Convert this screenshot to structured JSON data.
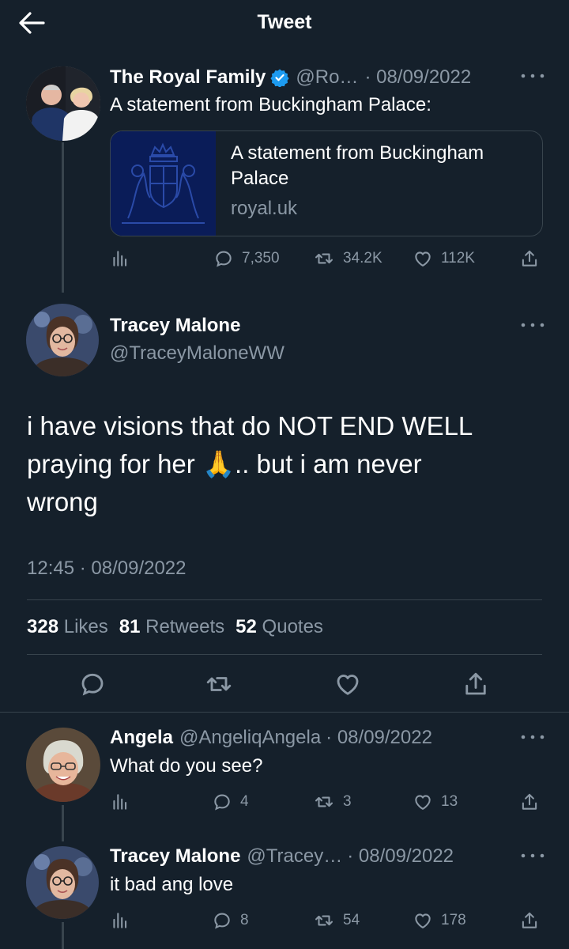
{
  "header": {
    "title": "Tweet"
  },
  "parent_tweet": {
    "display_name": "The Royal Family",
    "handle": "@Ro…",
    "date": "· 08/09/2022",
    "text": "A statement from Buckingham Palace:",
    "card": {
      "title": "A statement from Buckingham Palace",
      "domain": "royal.uk"
    },
    "actions": {
      "replies": "7,350",
      "retweets": "34.2K",
      "likes": "112K"
    }
  },
  "main_tweet": {
    "display_name": "Tracey Malone",
    "handle": "@TraceyMaloneWW",
    "text_line1": "i have  visions that do NOT END WELL",
    "text_line2_a": "praying for her ",
    "emoji": "🙏",
    "text_line2_b": ".. but i am never",
    "text_line3": "wrong",
    "timestamp": "12:45 · 08/09/2022",
    "stats": {
      "likes_count": "328",
      "likes_label": "Likes",
      "retweets_count": "81",
      "retweets_label": "Retweets",
      "quotes_count": "52",
      "quotes_label": "Quotes"
    }
  },
  "replies": [
    {
      "display_name": "Angela",
      "handle": "@AngeliqAngela",
      "date": "· 08/09/2022",
      "text": "What do you see?",
      "replies": "4",
      "retweets": "3",
      "likes": "13"
    },
    {
      "display_name": "Tracey Malone",
      "handle": "@Tracey…",
      "date": "· 08/09/2022",
      "text": "it bad ang love",
      "replies": "8",
      "retweets": "54",
      "likes": "178"
    }
  ],
  "colors": {
    "background": "#15202b",
    "muted": "#8b98a5",
    "divider": "#38444d",
    "verified": "#1d9bf0"
  }
}
